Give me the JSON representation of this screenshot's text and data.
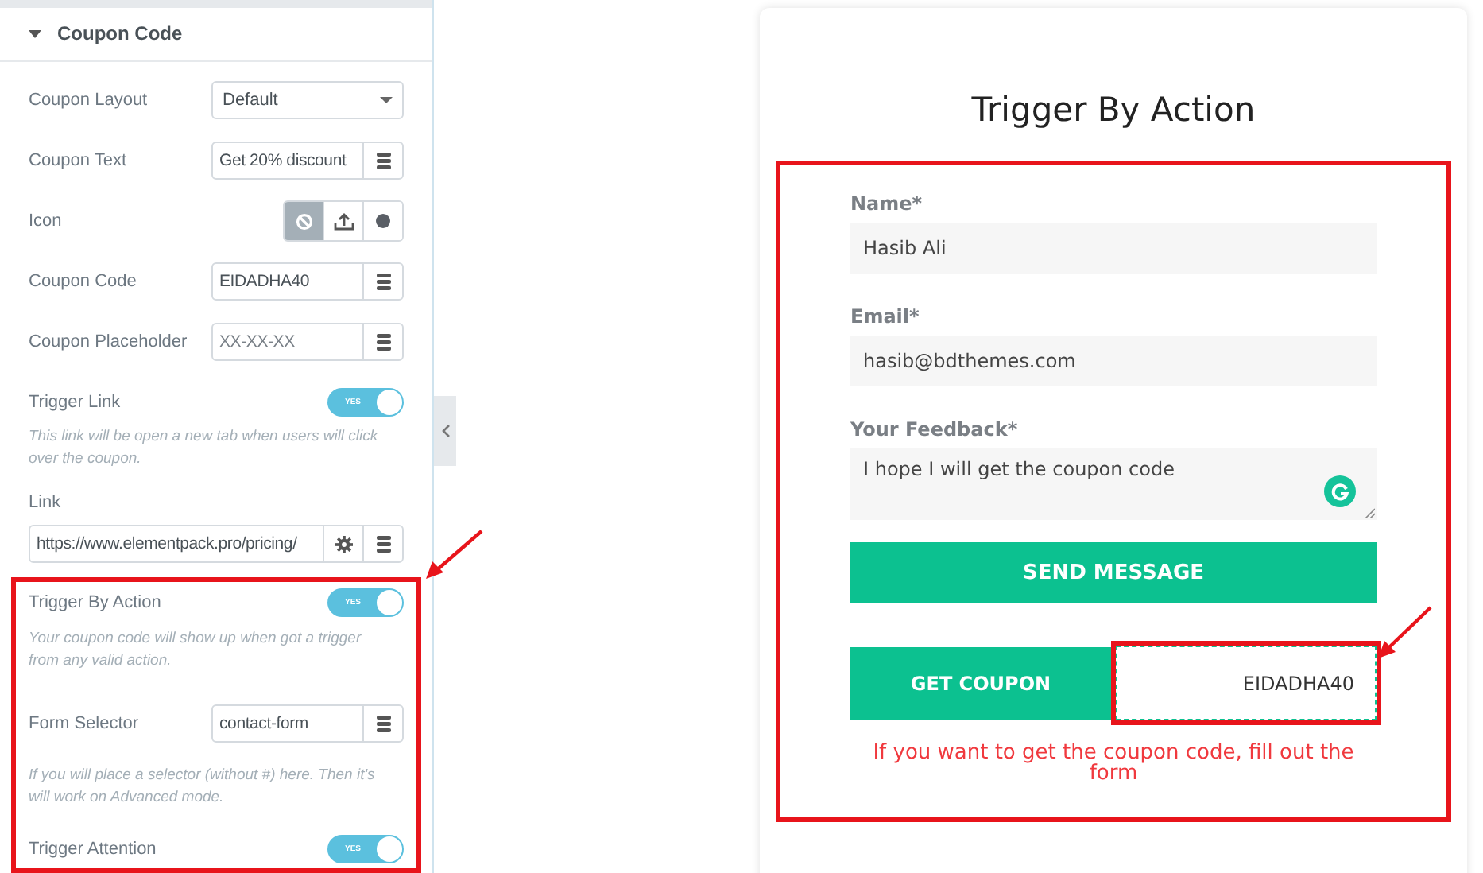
{
  "panel": {
    "section_title": "Coupon Code",
    "expanded": true,
    "controls": [
      {
        "kind": "select",
        "label": "Coupon Layout",
        "value": "Default"
      },
      {
        "kind": "text",
        "label": "Coupon Text",
        "value": "Get 20% discount"
      },
      {
        "kind": "choose",
        "label": "Icon",
        "options": [
          {
            "selected": true
          },
          {
            "selected": false
          },
          {
            "selected": false
          }
        ]
      },
      {
        "kind": "text",
        "label": "Coupon Code",
        "value": "EIDADHA40"
      },
      {
        "kind": "text",
        "label": "Coupon Placeholder",
        "placeholder": "XX-XX-XX"
      },
      {
        "kind": "switch",
        "label": "Trigger Link",
        "on": true,
        "switch_text": "YES"
      },
      {
        "kind": "note",
        "text": "This link will be open a new tab when users will click over the coupon."
      },
      {
        "kind": "url",
        "label": "Link",
        "value": "https://www.elementpack.pro/pricing/"
      }
    ],
    "highlighted_controls": [
      {
        "kind": "switch",
        "label": "Trigger By Action",
        "on": true,
        "switch_text": "YES"
      },
      {
        "kind": "note",
        "text": "Your coupon code will show up when got a trigger from any valid action."
      },
      {
        "kind": "text",
        "label": "Form Selector",
        "value": "contact-form"
      },
      {
        "kind": "note",
        "text": "If you will place a selector (without #) here. Then it's will work on Advanced mode."
      },
      {
        "kind": "switch",
        "label": "Trigger Attention",
        "on": true,
        "switch_text": "YES"
      }
    ]
  },
  "preview": {
    "title": "Trigger By Action",
    "fields": [
      {
        "kind": "input",
        "label": "Name*",
        "value": "Hasib Ali"
      },
      {
        "kind": "input",
        "label": "Email*",
        "value": "hasib@bdthemes.com"
      },
      {
        "kind": "textarea",
        "label": "Your Feedback*",
        "value": "I hope I will get the coupon code"
      }
    ],
    "submit_button": "SEND MESSAGE",
    "coupon_button": "GET COUPON",
    "coupon_code": "EIDADHA40",
    "message": "If you want to get the coupon code, fill out the form"
  }
}
